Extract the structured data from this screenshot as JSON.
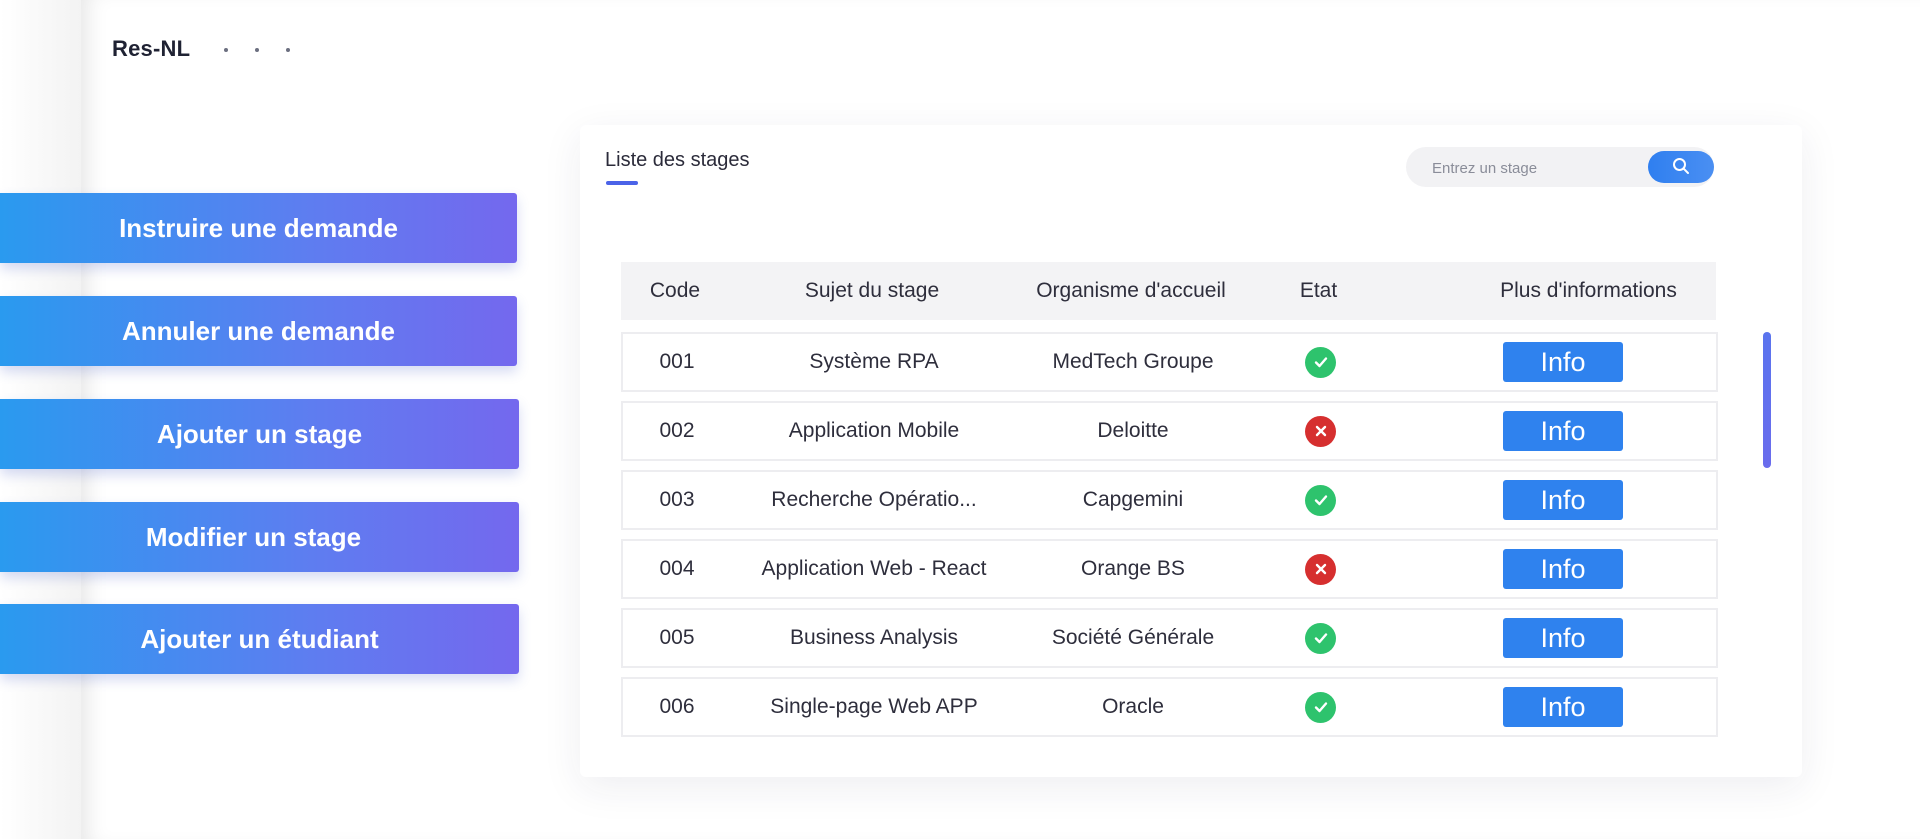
{
  "header": {
    "brand": "Res-NL"
  },
  "actions": [
    {
      "label": "Instruire une demande"
    },
    {
      "label": "Annuler une demande"
    },
    {
      "label": "Ajouter un stage"
    },
    {
      "label": "Modifier un stage"
    },
    {
      "label": "Ajouter un étudiant"
    }
  ],
  "card": {
    "title": "Liste des stages",
    "search": {
      "placeholder": "Entrez un stage",
      "icon": "search-icon"
    }
  },
  "table": {
    "columns": [
      "Code",
      "Sujet du stage",
      "Organisme d'accueil",
      "Etat",
      "Plus d'informations"
    ],
    "rows": [
      {
        "code": "001",
        "sujet": "Système RPA",
        "organisme": "MedTech Groupe",
        "etat": "ok",
        "info": "Info"
      },
      {
        "code": "002",
        "sujet": "Application Mobile",
        "organisme": "Deloitte",
        "etat": "ko",
        "info": "Info"
      },
      {
        "code": "003",
        "sujet": "Recherche Opératio...",
        "organisme": "Capgemini",
        "etat": "ok",
        "info": "Info"
      },
      {
        "code": "004",
        "sujet": "Application Web - React",
        "organisme": "Orange BS",
        "etat": "ko",
        "info": "Info"
      },
      {
        "code": "005",
        "sujet": "Business Analysis",
        "organisme": "Société Générale",
        "etat": "ok",
        "info": "Info"
      },
      {
        "code": "006",
        "sujet": "Single-page Web APP",
        "organisme": "Oracle",
        "etat": "ok",
        "info": "Info"
      }
    ]
  },
  "colors": {
    "ok": "#2ec36d",
    "ko": "#d62f2f",
    "info_button": "#2f82ee",
    "accent": "#4b63e8"
  }
}
